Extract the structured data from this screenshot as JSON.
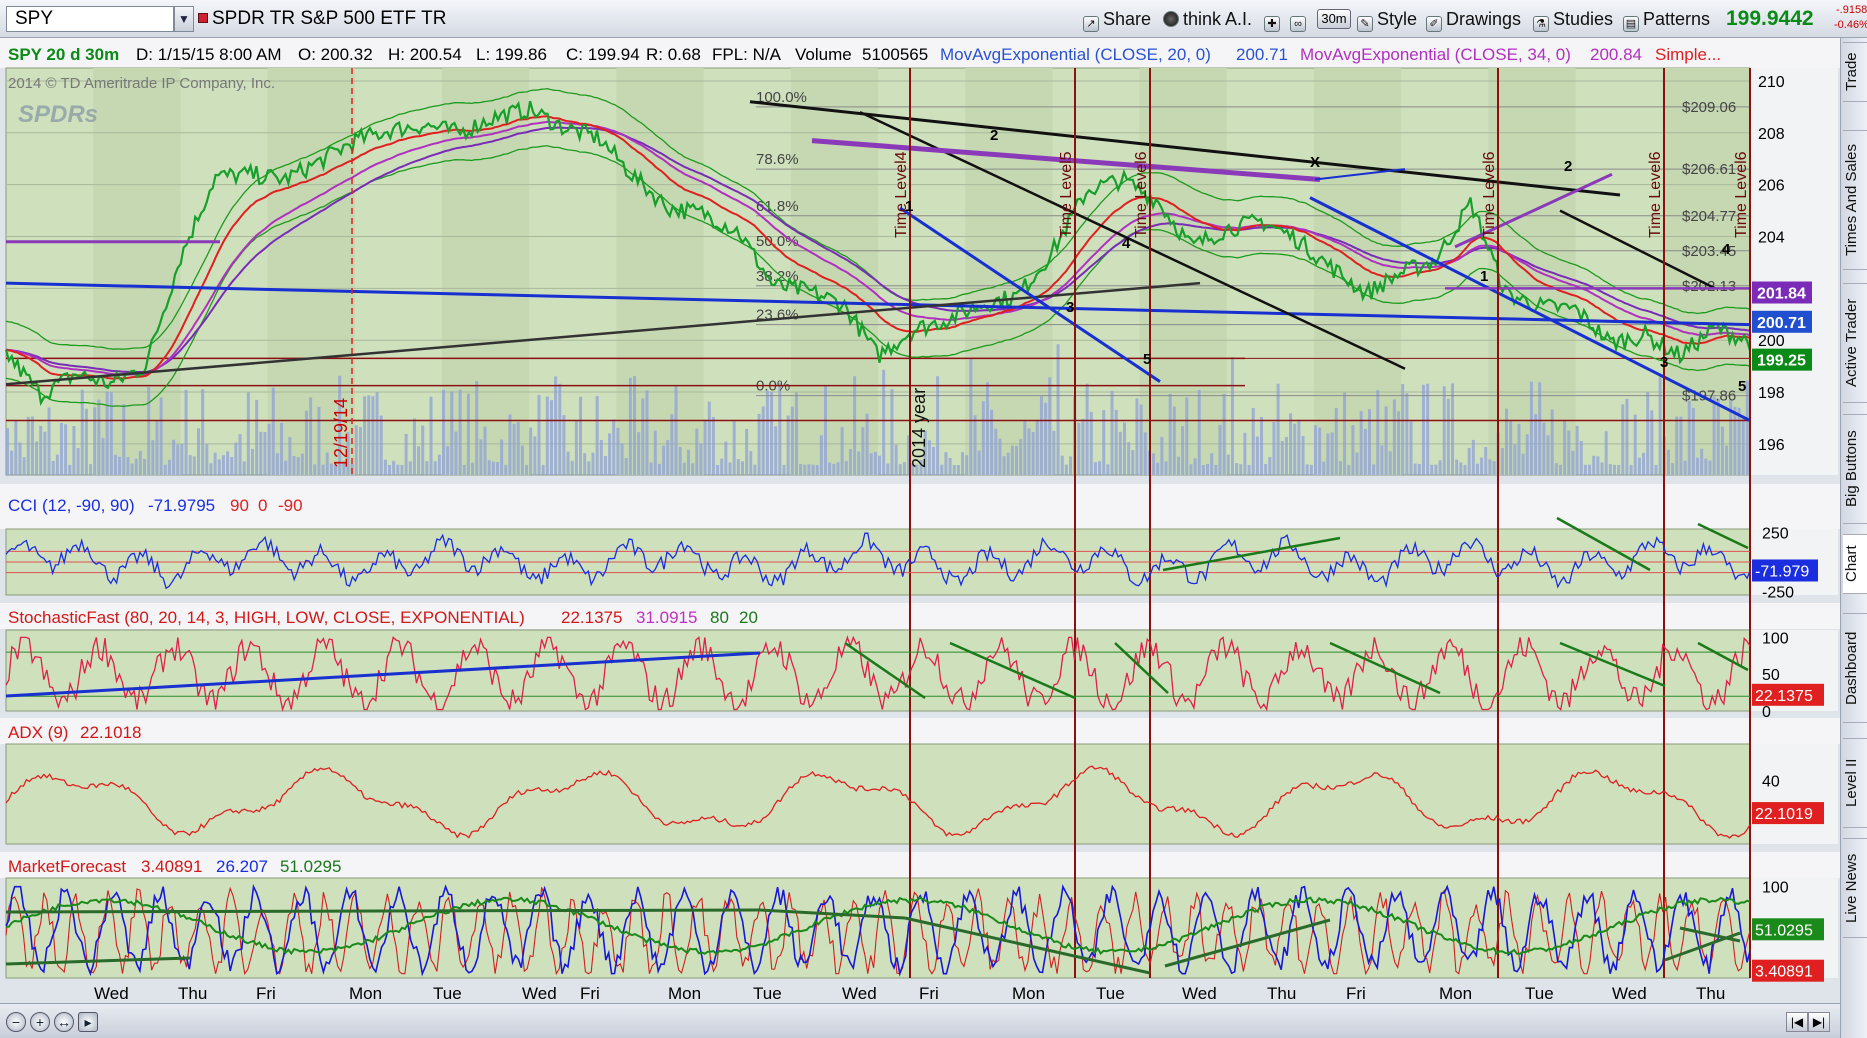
{
  "toolbar": {
    "symbol": "SPY",
    "description": "SPDR TR S&P 500 ETF TR",
    "share": "Share",
    "think_ai": "think A.I.",
    "interval": "30m",
    "style": "Style",
    "drawings": "Drawings",
    "studies": "Studies",
    "patterns": "Patterns",
    "last_price": "199.9442",
    "change_abs": "-.9158",
    "change_pct": "-0.46%"
  },
  "sidebar": {
    "tabs": [
      "Trade",
      "Times And Sales",
      "Active Trader",
      "Big Buttons",
      "Chart",
      "Dashboard",
      "Level II",
      "Live News"
    ]
  },
  "colors": {
    "panel_bg": "#cfe0bd",
    "price_line": "#16a02a",
    "ema20": "#e02020",
    "ema34": "#b030c0",
    "sma": "#7a2cb8",
    "cci": "#1a2ee0",
    "stoch_k": "#e0204a",
    "adx": "#e02020",
    "forecast_blue": "#1818d8",
    "forecast_green": "#1a8a1a",
    "forecast_red": "#d02020"
  },
  "chart_data": [
    {
      "type": "line",
      "name": "price",
      "header": {
        "symbol_period": "SPY 20 d 30m",
        "date": "D: 1/15/15 8:00 AM",
        "open": "O: 200.32",
        "high": "H: 200.54",
        "low": "L: 199.86",
        "close": "C: 199.94",
        "range": "R: 0.68",
        "fpl": "FPL: N/A",
        "volume_label": "Volume",
        "volume_value": "5100565",
        "ema20_label": "MovAvgExponential (CLOSE, 20, 0)",
        "ema20_value": "200.71",
        "ema34_label": "MovAvgExponential (CLOSE, 34, 0)",
        "ema34_value": "200.84",
        "sma_label": "Simple..."
      },
      "copyright": "2014 © TD Ameritrade IP Company, Inc.",
      "watermark": "SPDRs",
      "ylim": [
        194.8,
        210.5
      ],
      "yticks": [
        196,
        198,
        200,
        202,
        204,
        206,
        208,
        210
      ],
      "days": [
        "Wed",
        "Thu",
        "Fri",
        "Mon",
        "Tue",
        "Wed",
        "Fri",
        "Mon",
        "Tue",
        "Wed",
        "Fri",
        "Mon",
        "Tue",
        "Wed",
        "Thu",
        "Fri",
        "Mon",
        "Tue",
        "Wed",
        "Thu"
      ],
      "closes": [
        199.5,
        197.9,
        198.7,
        198.3,
        199.0,
        203.2,
        206.3,
        206.4,
        206.2,
        206.9,
        207.7,
        208.1,
        208.3,
        208.0,
        208.6,
        208.9,
        208.2,
        207.8,
        206.3,
        205.1,
        204.9,
        204.2,
        202.1,
        201.9,
        201.4,
        199.4,
        200.4,
        200.8,
        201.4,
        201.7,
        203.4,
        205.8,
        206.2,
        205.4,
        203.6,
        204.3,
        204.6,
        203.9,
        202.8,
        201.8,
        202.6,
        203.1,
        205.3,
        201.8,
        201.3,
        201.2,
        199.9,
        200.2,
        199.4,
        200.5,
        199.94
      ],
      "fib_levels": [
        {
          "label": "100.0%",
          "value": 209.0,
          "price": "$209.06"
        },
        {
          "label": "78.6%",
          "value": 206.6,
          "price": "$206.61"
        },
        {
          "label": "61.8%",
          "value": 204.8,
          "price": "$204.77"
        },
        {
          "label": "50.0%",
          "value": 203.45,
          "price": "$203.45"
        },
        {
          "label": "38.2%",
          "value": 202.1,
          "price": "$202.13"
        },
        {
          "label": "23.6%",
          "value": 200.6,
          "price": ""
        },
        {
          "label": "0.0%",
          "value": 197.86,
          "price": "$197.86"
        }
      ],
      "price_labels": [
        {
          "text": "201.84",
          "value": 201.84,
          "color": "#7a2cb8"
        },
        {
          "text": "200.71",
          "value": 200.71,
          "color": "#2050d0"
        },
        {
          "text": "199.25",
          "value": 199.25,
          "color": "#0a8a16"
        }
      ],
      "time_level_labels": [
        "Time Level4",
        "Time Level5",
        "Time Level6",
        "Time Level6",
        "Time Level6",
        "Time Level6"
      ],
      "annotations": {
        "date_1": "12/19/14",
        "year_marker": "2014 year",
        "wave_labels": [
          "1",
          "2",
          "3",
          "4",
          "5",
          "X",
          "1",
          "2",
          "3",
          "4",
          "5"
        ]
      }
    },
    {
      "type": "line",
      "name": "cci",
      "title": "CCI (12, -90, 90)",
      "value": "-71.9795",
      "levels": [
        "90",
        "0",
        "-90"
      ],
      "ylim": [
        -280,
        280
      ],
      "yticks": [
        250,
        -250
      ],
      "tick_labels": [
        "250",
        "-250"
      ],
      "last_label": "-71.979"
    },
    {
      "type": "line",
      "name": "stochastic",
      "title": "StochasticFast (80, 20, 14, 3, HIGH, LOW, CLOSE, EXPONENTIAL)",
      "k_value": "22.1375",
      "d_value": "31.0915",
      "over_bought": "80",
      "over_sold": "20",
      "ylim": [
        0,
        110
      ],
      "yticks": [
        100,
        50,
        0
      ],
      "tick_labels": [
        "100",
        "50",
        "0"
      ],
      "last_label": "22.1375"
    },
    {
      "type": "line",
      "name": "adx",
      "title": "ADX (9)",
      "value": "22.1018",
      "ylim": [
        5,
        60
      ],
      "yticks": [
        40
      ],
      "tick_labels": [
        "40"
      ],
      "last_label": "22.1019"
    },
    {
      "type": "line",
      "name": "market_forecast",
      "title": "MarketForecast",
      "values": [
        "3.40891",
        "26.207",
        "51.0295"
      ],
      "ylim": [
        -5,
        110
      ],
      "yticks": [
        100,
        50
      ],
      "tick_labels": [
        "100",
        "50"
      ],
      "last_labels": [
        "51.0295",
        "3.40891"
      ]
    }
  ],
  "x_axis": {
    "day_labels": [
      "Wed",
      "Thu",
      "Fri",
      "Mon",
      "Tue",
      "Wed",
      "Fri",
      "Mon",
      "Tue",
      "Wed",
      "Fri",
      "Mon",
      "Tue",
      "Wed",
      "Thu",
      "Fri",
      "Mon",
      "Tue",
      "Wed",
      "Thu"
    ]
  }
}
